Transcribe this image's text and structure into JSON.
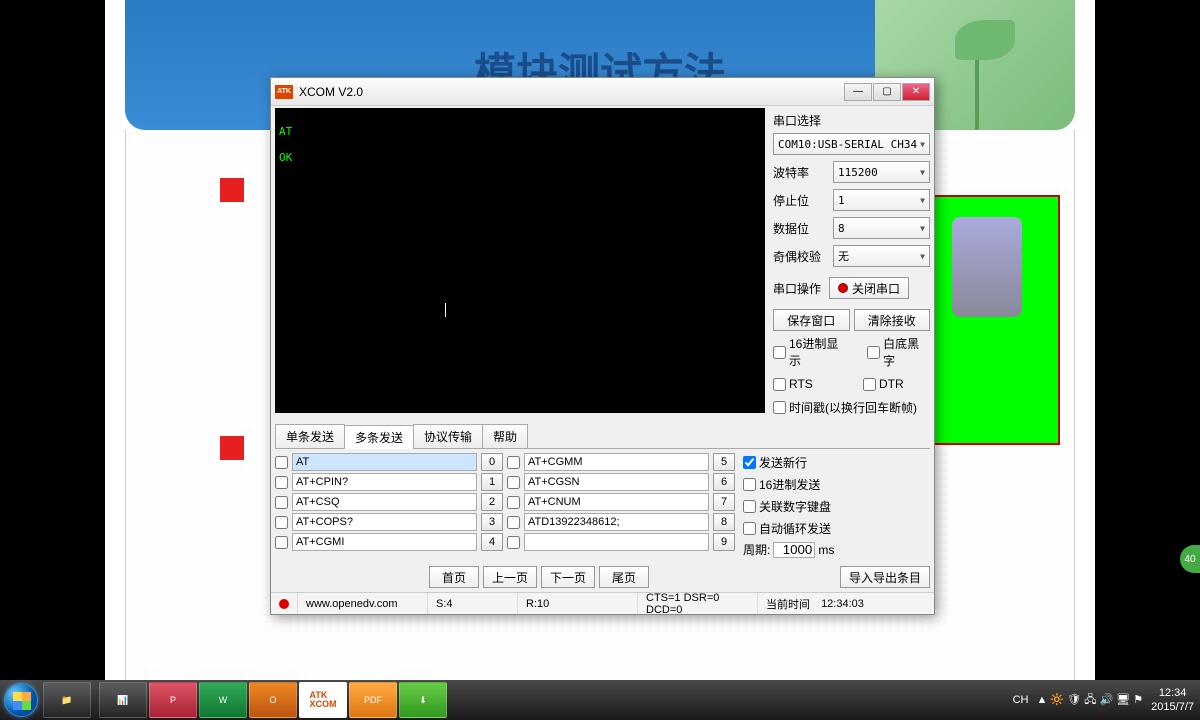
{
  "slide": {
    "title": "模块测试方法"
  },
  "window": {
    "title": "XCOM V2.0",
    "icon_text": "ATK"
  },
  "terminal": {
    "line1": "AT",
    "line2": "OK"
  },
  "serial": {
    "section_label": "串口选择",
    "port": "COM10:USB-SERIAL CH34",
    "baud_label": "波特率",
    "baud": "115200",
    "stop_label": "停止位",
    "stop": "1",
    "data_label": "数据位",
    "data": "8",
    "parity_label": "奇偶校验",
    "parity": "无",
    "op_label": "串口操作",
    "op_btn": "关闭串口",
    "save_btn": "保存窗口",
    "clear_btn": "清除接收",
    "hex_disp": "16进制显示",
    "white_bg": "白底黑字",
    "rts": "RTS",
    "dtr": "DTR",
    "timestamp": "时间戳(以换行回车断帧)"
  },
  "tabs": {
    "single": "单条发送",
    "multi": "多条发送",
    "proto": "协议传输",
    "help": "帮助"
  },
  "multi": {
    "left": [
      "AT",
      "AT+CPIN?",
      "AT+CSQ",
      "AT+COPS?",
      "AT+CGMI"
    ],
    "right": [
      "AT+CGMM",
      "AT+CGSN",
      "AT+CNUM",
      "ATD13922348612;",
      ""
    ],
    "btns_l": [
      "0",
      "1",
      "2",
      "3",
      "4"
    ],
    "btns_r": [
      "5",
      "6",
      "7",
      "8",
      "9"
    ]
  },
  "opts": {
    "send_newline": "发送新行",
    "hex_send": "16进制发送",
    "numpad": "关联数字键盘",
    "auto_loop": "自动循环发送",
    "period_label": "周期:",
    "period_val": "1000",
    "period_unit": "ms"
  },
  "nav": {
    "first": "首页",
    "prev": "上一页",
    "next": "下一页",
    "last": "尾页",
    "import": "导入导出条目"
  },
  "status": {
    "url": "www.openedv.com",
    "s": "S:4",
    "r": "R:10",
    "signals": "CTS=1 DSR=0 DCD=0",
    "time_label": "当前时间",
    "time": "12:34:03"
  },
  "taskbar": {
    "items": [
      "📁",
      "📊",
      "P",
      "W",
      "O",
      "ATK\nXCOM",
      "PDF",
      "⬇"
    ],
    "lang": "CH",
    "clock_time": "12:34",
    "clock_date": "2015/7/7"
  },
  "badge": "40"
}
